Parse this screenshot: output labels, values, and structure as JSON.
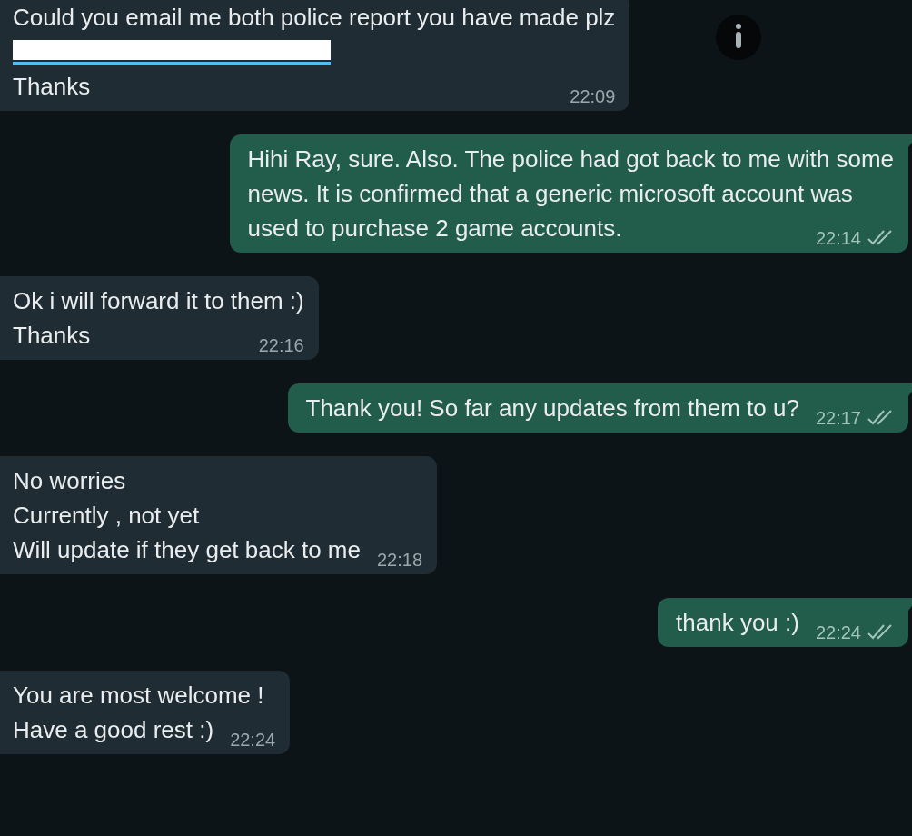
{
  "messages": [
    {
      "outgoing": false,
      "lines": [
        {
          "kind": "text",
          "text": "Could you email me both police report you have made plz"
        },
        {
          "kind": "redacted"
        },
        {
          "kind": "text",
          "text": "Thanks"
        }
      ],
      "time": "22:09"
    },
    {
      "outgoing": true,
      "lines": [
        {
          "kind": "text",
          "text": "Hihi Ray, sure. Also. The police had got back to me with some"
        },
        {
          "kind": "text",
          "text": "news. It is confirmed that a generic microsoft account was"
        },
        {
          "kind": "text",
          "text": "used to purchase 2 game accounts."
        }
      ],
      "time": "22:14",
      "read": false
    },
    {
      "outgoing": false,
      "lines": [
        {
          "kind": "text",
          "text": "Ok i will forward it to them :)"
        },
        {
          "kind": "text",
          "text": "Thanks"
        }
      ],
      "time": "22:16"
    },
    {
      "outgoing": true,
      "lines": [
        {
          "kind": "text",
          "text": "Thank you! So far any updates from them to u?"
        }
      ],
      "time": "22:17",
      "read": false
    },
    {
      "outgoing": false,
      "lines": [
        {
          "kind": "text",
          "text": "No worries"
        },
        {
          "kind": "text",
          "text": "Currently , not yet"
        },
        {
          "kind": "text",
          "text": "Will update if they get back to me"
        }
      ],
      "time": "22:18"
    },
    {
      "outgoing": true,
      "lines": [
        {
          "kind": "text",
          "text": "thank you :)"
        }
      ],
      "time": "22:24",
      "read": false
    },
    {
      "outgoing": false,
      "lines": [
        {
          "kind": "text",
          "text": "You are most welcome !"
        },
        {
          "kind": "text",
          "text": "Have a good rest :)"
        }
      ],
      "time": "22:24"
    }
  ]
}
